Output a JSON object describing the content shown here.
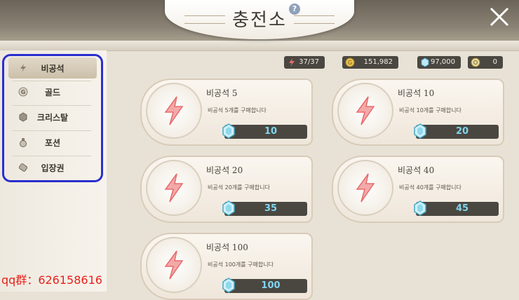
{
  "header": {
    "title": "충전소",
    "help": "?"
  },
  "sidebar": {
    "items": [
      {
        "label": "비공석",
        "icon": "lightning-icon",
        "active": true
      },
      {
        "label": "골드",
        "icon": "gold-coin-icon",
        "active": false
      },
      {
        "label": "크리스탈",
        "icon": "crystal-icon",
        "active": false
      },
      {
        "label": "포션",
        "icon": "potion-icon",
        "active": false
      },
      {
        "label": "입장권",
        "icon": "ticket-icon",
        "active": false
      }
    ]
  },
  "currencies": [
    {
      "icon": "lightning-icon",
      "value": "37/37"
    },
    {
      "icon": "gold-coin-icon",
      "value": "151,982"
    },
    {
      "icon": "crystal-icon",
      "value": "97,000"
    },
    {
      "icon": "token-icon",
      "value": "0"
    }
  ],
  "products": [
    {
      "name": "비공석 5",
      "desc": "비공석 5개를 구매합니다",
      "price": "10"
    },
    {
      "name": "비공석 10",
      "desc": "비공석 10개를 구매합니다",
      "price": "20"
    },
    {
      "name": "비공석 20",
      "desc": "비공석 20개를 구매합니다",
      "price": "35"
    },
    {
      "name": "비공석 40",
      "desc": "비공석 40개를 구매합니다",
      "price": "45"
    },
    {
      "name": "비공석 100",
      "desc": "비공석 100개를 구매합니다",
      "price": "100"
    }
  ],
  "footer": {
    "watermark": "qq群：626158616"
  },
  "colors": {
    "accent": "#2a2fcf",
    "price_text": "#7fd6f0",
    "lightning": "#e86b6b"
  }
}
